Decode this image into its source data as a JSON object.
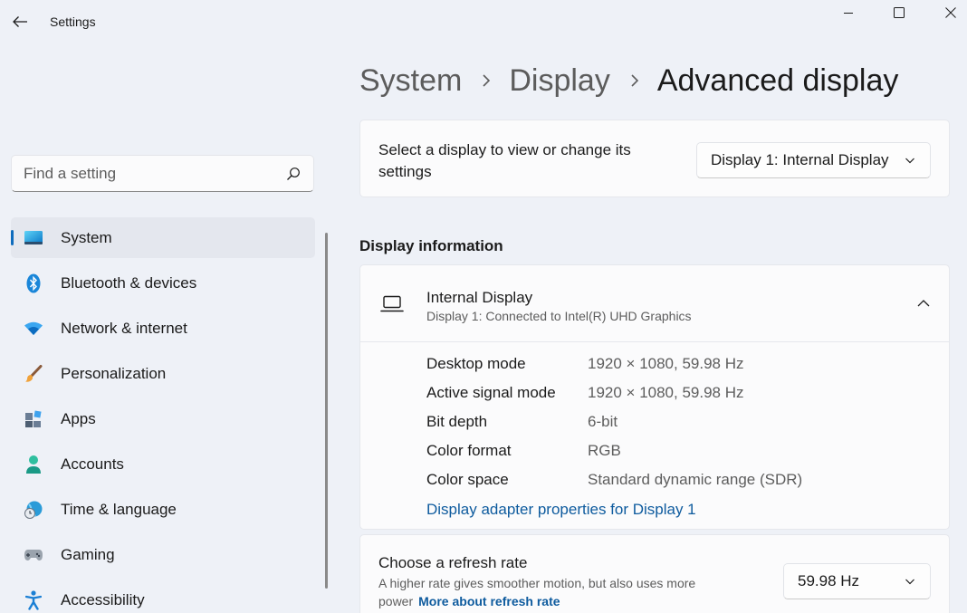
{
  "window": {
    "title": "Settings"
  },
  "search": {
    "placeholder": "Find a setting"
  },
  "sidebar": {
    "items": [
      {
        "label": "System",
        "icon": "system-icon",
        "active": true
      },
      {
        "label": "Bluetooth & devices",
        "icon": "bluetooth-icon"
      },
      {
        "label": "Network & internet",
        "icon": "wifi-icon"
      },
      {
        "label": "Personalization",
        "icon": "brush-icon"
      },
      {
        "label": "Apps",
        "icon": "apps-icon"
      },
      {
        "label": "Accounts",
        "icon": "accounts-icon"
      },
      {
        "label": "Time & language",
        "icon": "time-language-icon"
      },
      {
        "label": "Gaming",
        "icon": "gaming-icon"
      },
      {
        "label": "Accessibility",
        "icon": "accessibility-icon"
      }
    ]
  },
  "breadcrumb": [
    "System",
    "Display",
    "Advanced display"
  ],
  "display_select": {
    "label": "Select a display to view or change its settings",
    "value": "Display 1: Internal Display"
  },
  "display_info": {
    "section_title": "Display information",
    "title": "Internal Display",
    "subtitle": "Display 1: Connected to Intel(R) UHD Graphics",
    "rows": [
      {
        "key": "Desktop mode",
        "value": "1920 × 1080, 59.98 Hz"
      },
      {
        "key": "Active signal mode",
        "value": "1920 × 1080, 59.98 Hz"
      },
      {
        "key": "Bit depth",
        "value": "6-bit"
      },
      {
        "key": "Color format",
        "value": "RGB"
      },
      {
        "key": "Color space",
        "value": "Standard dynamic range (SDR)"
      }
    ],
    "link": "Display adapter properties for Display 1"
  },
  "refresh_rate": {
    "title": "Choose a refresh rate",
    "description": "A higher rate gives smoother motion, but also uses more power",
    "more_link": "More about refresh rate",
    "value": "59.98 Hz"
  },
  "colors": {
    "accent": "#0f6cbd",
    "link": "#0e5b9e",
    "background": "#eef1f7",
    "card": "#fbfbfc"
  }
}
